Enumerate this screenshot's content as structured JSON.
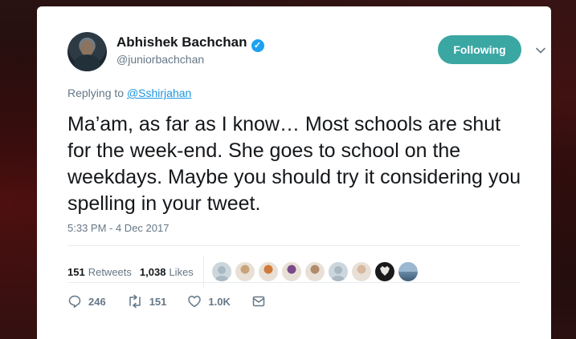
{
  "author": {
    "name": "Abhishek Bachchan",
    "handle": "@juniorbachchan",
    "verified_glyph": "✓"
  },
  "follow_button": {
    "label": "Following",
    "color": "#3aa7a3"
  },
  "reply": {
    "prefix": "Replying to ",
    "mention": "@Sshirjahan"
  },
  "tweet": {
    "text": "Ma’am, as far as I know… Most schools are shut for the week-end. She goes to school on the weekdays. Maybe you should try it considering you spelling in your tweet."
  },
  "timestamp": "5:33 PM - 4 Dec 2017",
  "stats": {
    "retweets_count": "151",
    "retweets_label": "Retweets",
    "likes_count": "1,038",
    "likes_label": "Likes"
  },
  "liker_avatars": [
    {
      "icon": "default-avatar",
      "color": "#aab8c2"
    },
    {
      "icon": "person-avatar",
      "color": "#c8a27a"
    },
    {
      "icon": "person-avatar",
      "color": "#d07a3a"
    },
    {
      "icon": "person-avatar",
      "color": "#7a4a8a"
    },
    {
      "icon": "person-avatar",
      "color": "#b08a6a"
    },
    {
      "icon": "default-avatar",
      "color": "#aab8c2"
    },
    {
      "icon": "person-avatar",
      "color": "#d8b8a0"
    },
    {
      "icon": "wolf-avatar",
      "color": "#1a1a1a"
    },
    {
      "icon": "landscape-avatar",
      "color": "#6a8aa8"
    }
  ],
  "actions": {
    "reply_count": "246",
    "retweet_count": "151",
    "like_count": "1.0K"
  },
  "colors": {
    "link": "#1b95e0",
    "muted": "#657786",
    "text": "#14171a",
    "verified": "#1da1f2"
  }
}
